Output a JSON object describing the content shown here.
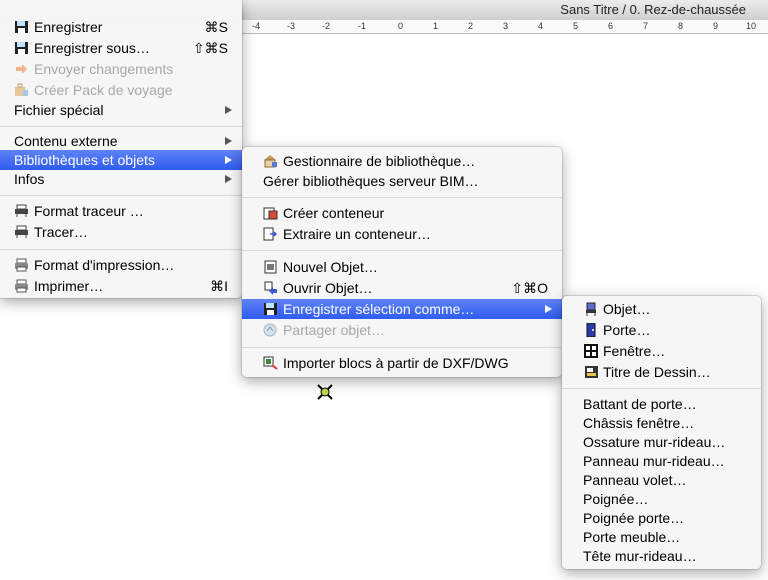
{
  "window": {
    "title": "Sans Titre / 0. Rez-de-chaussée"
  },
  "ruler": {
    "ticks": [
      "-4",
      "-3",
      "-2",
      "-1",
      "0",
      "1",
      "2",
      "3",
      "4",
      "5",
      "6",
      "7",
      "8",
      "9",
      "10"
    ]
  },
  "file_menu": {
    "items": [
      {
        "label": "Enregistrer",
        "shortcut": "⌘S",
        "icon": "floppy-icon"
      },
      {
        "label": "Enregistrer sous…",
        "shortcut": "⇧⌘S",
        "icon": "floppy-icon"
      },
      {
        "label": "Envoyer changements",
        "icon": "send-arrow-icon",
        "disabled": true
      },
      {
        "label": "Créer Pack de voyage",
        "icon": "travel-pack-icon",
        "disabled": true
      },
      {
        "label": "Fichier spécial",
        "submenu": true
      },
      {
        "label": "Contenu externe",
        "submenu": true
      },
      {
        "label": "Bibliothèques et objets",
        "submenu": true,
        "selected": true
      },
      {
        "label": "Infos",
        "submenu": true
      },
      {
        "label": "Format traceur …",
        "icon": "plotter-icon"
      },
      {
        "label": "Tracer…",
        "icon": "plotter-icon"
      },
      {
        "label": "Format d'impression…",
        "icon": "printer-icon"
      },
      {
        "label": "Imprimer…",
        "shortcut": "⌘I",
        "icon": "printer-icon"
      }
    ]
  },
  "library_menu": {
    "items": [
      {
        "label": "Gestionnaire de bibliothèque…",
        "icon": "library-manager-icon"
      },
      {
        "label": "Gérer bibliothèques serveur BIM…"
      },
      {
        "label": "Créer conteneur",
        "icon": "container-create-icon"
      },
      {
        "label": "Extraire un conteneur…",
        "icon": "container-extract-icon"
      },
      {
        "label": "Nouvel Objet…",
        "icon": "new-object-icon"
      },
      {
        "label": "Ouvrir Objet…",
        "shortcut": "⇧⌘O",
        "icon": "open-object-icon"
      },
      {
        "label": "Enregistrer sélection comme…",
        "icon": "floppy-icon",
        "submenu": true,
        "selected": true
      },
      {
        "label": "Partager objet…",
        "icon": "share-icon",
        "disabled": true
      },
      {
        "label": "Importer blocs à partir de DXF/DWG",
        "icon": "import-dxf-icon"
      }
    ]
  },
  "save_as_menu": {
    "items": [
      {
        "label": "Objet…",
        "icon": "object-icon"
      },
      {
        "label": "Porte…",
        "icon": "door-icon"
      },
      {
        "label": "Fenêtre…",
        "icon": "window-icon"
      },
      {
        "label": "Titre de Dessin…",
        "icon": "drawing-title-icon"
      },
      {
        "label": "Battant de porte…"
      },
      {
        "label": "Châssis fenêtre…"
      },
      {
        "label": "Ossature mur-rideau…"
      },
      {
        "label": "Panneau mur-rideau…"
      },
      {
        "label": "Panneau volet…"
      },
      {
        "label": "Poignée…"
      },
      {
        "label": "Poignée porte…"
      },
      {
        "label": "Porte meuble…"
      },
      {
        "label": "Tête mur-rideau…"
      }
    ]
  },
  "colors": {
    "selection": "#3a64f3",
    "disabled_text": "#a7a7a7"
  }
}
